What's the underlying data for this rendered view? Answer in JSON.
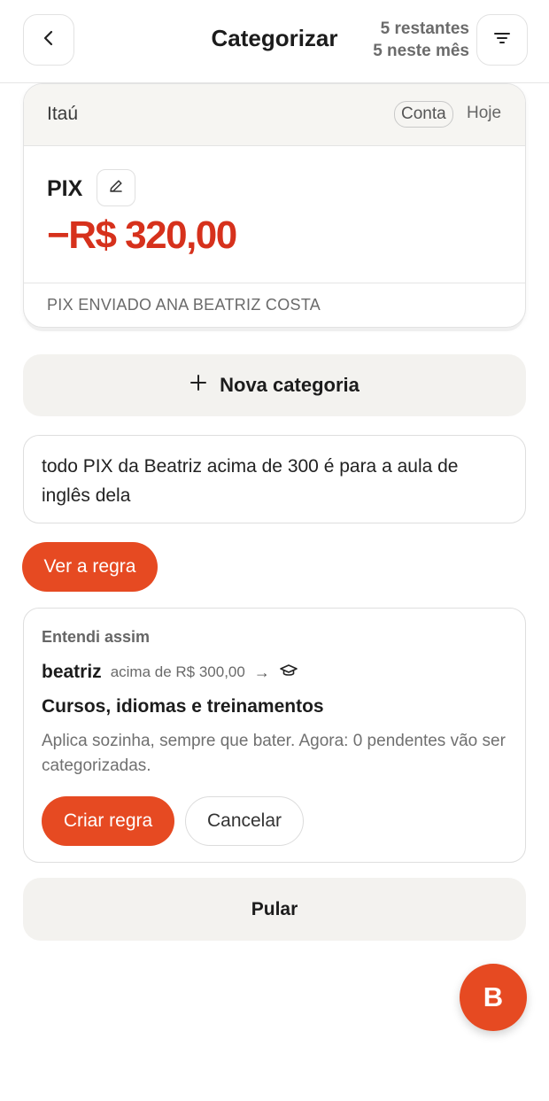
{
  "header": {
    "title": "Categorizar",
    "remaining": "5 restantes",
    "this_month": "5 neste mês",
    "back_icon": "chevron-left-icon",
    "filter_icon": "filter-lines-icon"
  },
  "transaction": {
    "bank": "Itaú",
    "account_chip": "Conta",
    "date": "Hoje",
    "name": "PIX",
    "amount": "−R$ 320,00",
    "description": "PIX ENVIADO ANA BEATRIZ COSTA",
    "edit_icon": "pencil-icon"
  },
  "new_category": {
    "label": "Nova categoria",
    "icon": "plus-icon"
  },
  "rule_input": {
    "value": "todo PIX da Beatriz acima de 300 é para a aula de inglês dela"
  },
  "see_rule": {
    "label": "Ver a regra"
  },
  "understood": {
    "heading": "Entendi assim",
    "who": "beatriz",
    "condition": "acima de R$ 300,00",
    "arrow": "→",
    "category_icon": "graduation-cap-icon",
    "category": "Cursos, idiomas e treinamentos",
    "note": "Aplica sozinha, sempre que bater. Agora: 0 pendentes vão ser categorizadas.",
    "create_label": "Criar regra",
    "cancel_label": "Cancelar"
  },
  "skip": {
    "label": "Pular"
  },
  "fab": {
    "label": "B"
  },
  "colors": {
    "accent": "#e64a22",
    "negative_amount": "#d6311c",
    "soft_surface": "#f3f2ef"
  }
}
